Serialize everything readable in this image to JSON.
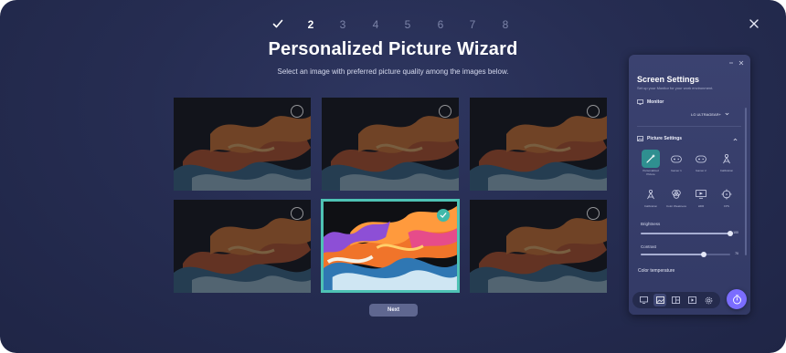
{
  "wizard": {
    "steps": [
      {
        "label": "✓",
        "state": "done"
      },
      {
        "label": "2",
        "state": "current"
      },
      {
        "label": "3",
        "state": "todo"
      },
      {
        "label": "4",
        "state": "todo"
      },
      {
        "label": "5",
        "state": "todo"
      },
      {
        "label": "6",
        "state": "todo"
      },
      {
        "label": "7",
        "state": "todo"
      },
      {
        "label": "8",
        "state": "todo"
      }
    ],
    "title": "Personalized Picture Wizard",
    "subtitle": "Select an image with preferred picture quality among the images below.",
    "images": [
      {
        "selected": false
      },
      {
        "selected": false
      },
      {
        "selected": false
      },
      {
        "selected": false
      },
      {
        "selected": true
      },
      {
        "selected": false
      }
    ],
    "next_label": "Next",
    "close_icon": "close-icon"
  },
  "panel": {
    "title": "Screen Settings",
    "subtitle": "Set up your Monitor for your work environment.",
    "monitor_label": "Monitor",
    "monitor_name": "LG ULTRAGEAR+",
    "picture_settings_label": "Picture Settings",
    "modes": [
      {
        "label": "Personalized Picture",
        "icon": "wand-icon",
        "active": true
      },
      {
        "label": "Gamer 1",
        "icon": "gamepad-icon",
        "active": false
      },
      {
        "label": "Gamer 2",
        "icon": "gamepad-icon",
        "active": false
      },
      {
        "label": "Calibration",
        "icon": "calibration-icon",
        "active": false
      },
      {
        "label": "Calibration",
        "icon": "calibration-icon",
        "active": false
      },
      {
        "label": "Color Weakness",
        "icon": "color-weakness-icon",
        "active": false
      },
      {
        "label": "HDR",
        "icon": "hdr-icon",
        "active": false
      },
      {
        "label": "FPS",
        "icon": "crosshair-icon",
        "active": false
      }
    ],
    "brightness": {
      "label": "Brightness",
      "value": 100,
      "max": 100
    },
    "contrast": {
      "label": "Contrast",
      "value": 70,
      "max": 100
    },
    "color_temperature_label": "Color temperature",
    "dock_icons": [
      "display-icon",
      "picture-icon",
      "screen-split-icon",
      "media-icon",
      "settings-icon"
    ],
    "accent": "#7b6dff",
    "selection_color": "#4ec2b4"
  }
}
